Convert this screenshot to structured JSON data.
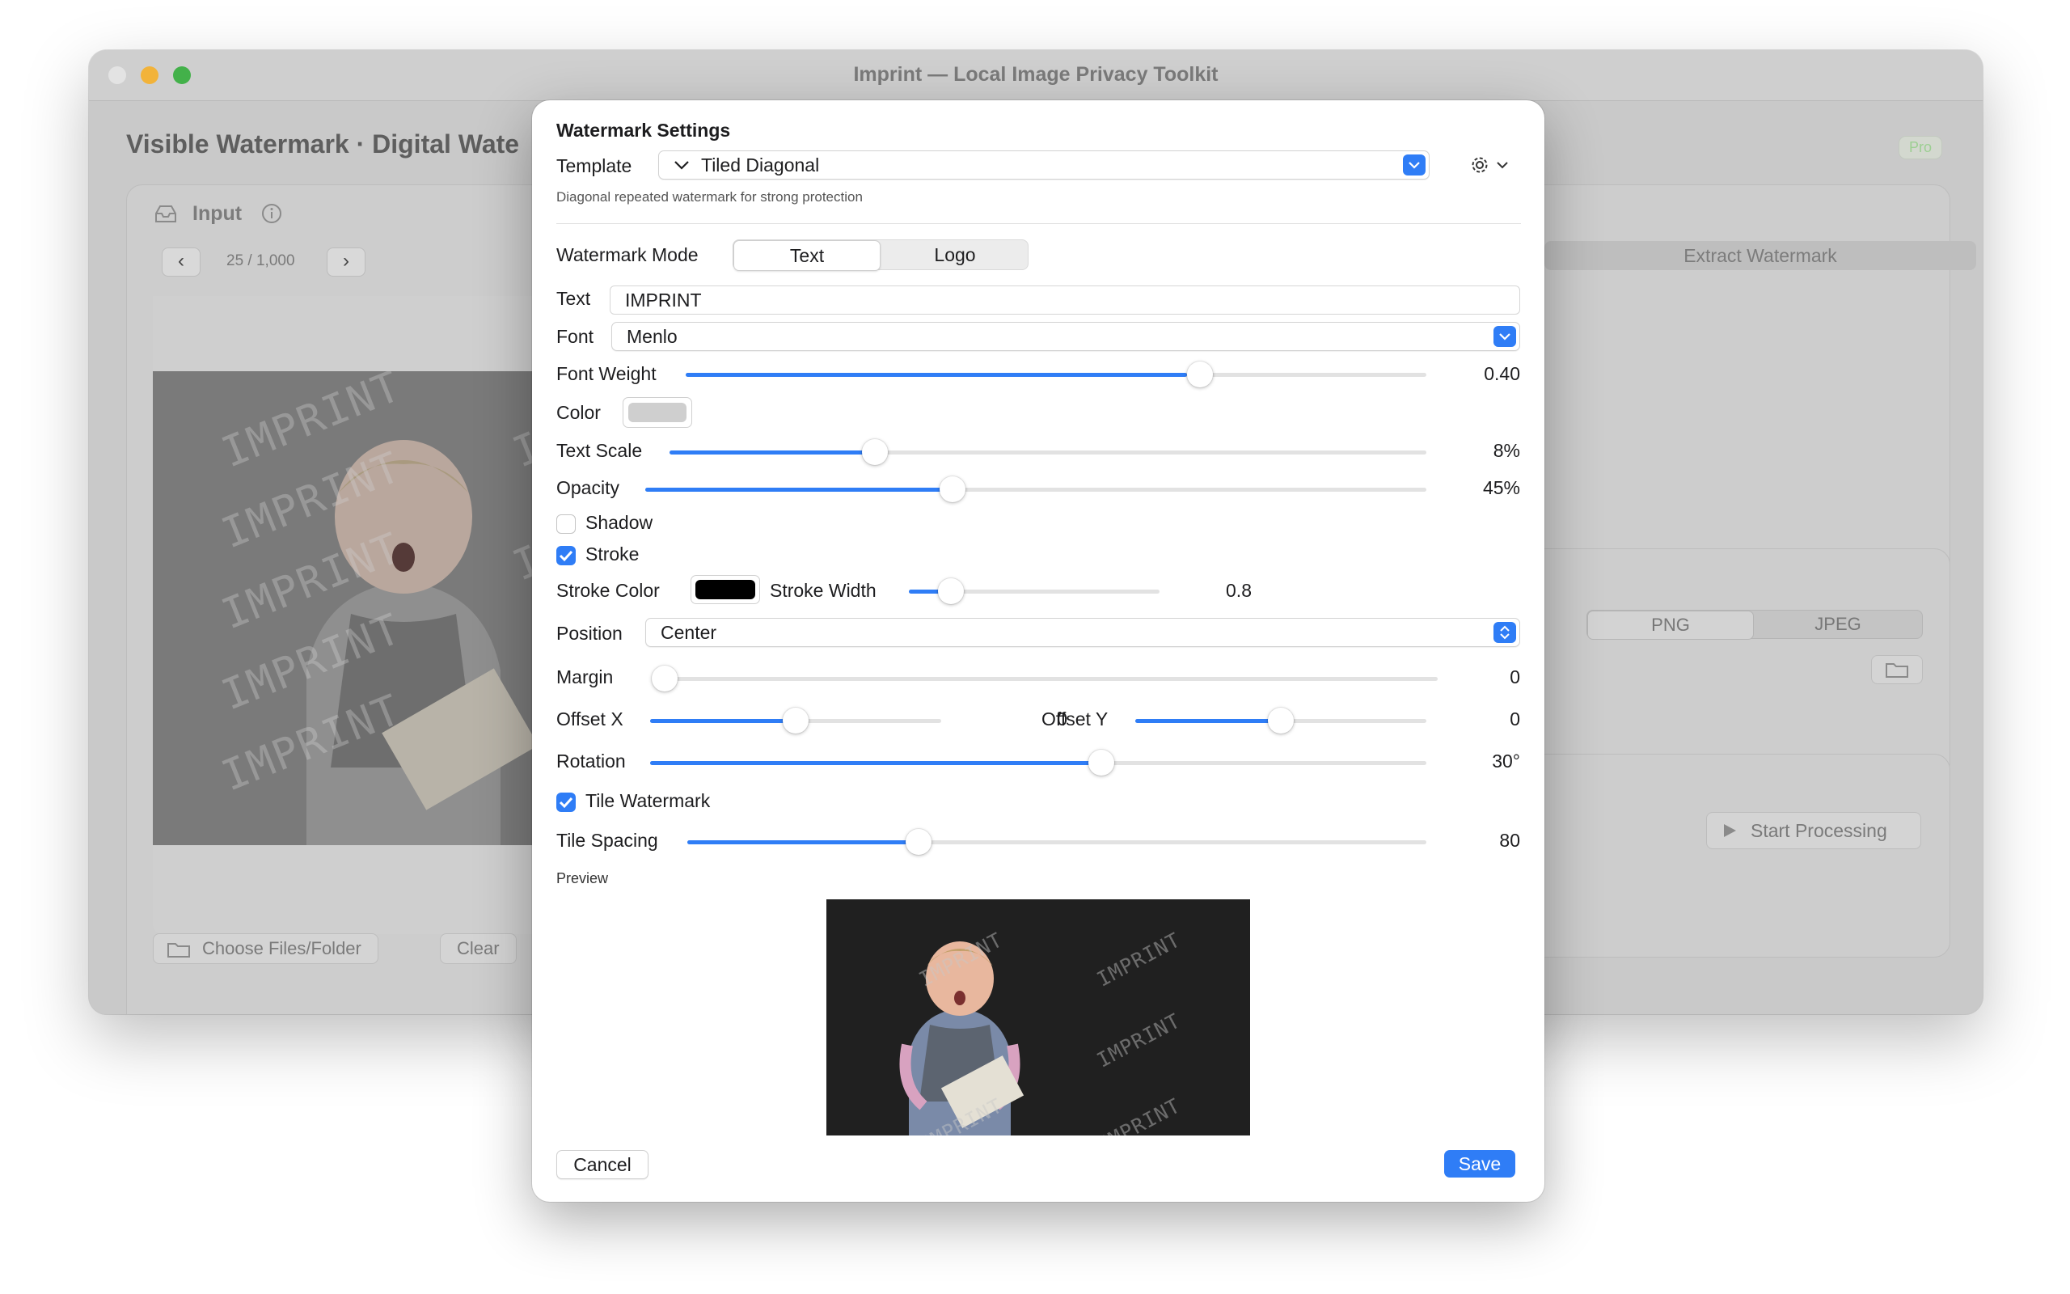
{
  "window": {
    "title": "Imprint — Local Image Privacy Toolkit",
    "page_title": "Visible Watermark · Digital Wate",
    "pro_badge": "Pro"
  },
  "input_panel": {
    "heading": "Input",
    "pager": "25 / 1,000",
    "watermark_text": "IMPRINT",
    "choose_label": "Choose Files/Folder",
    "clear_label": "Clear"
  },
  "right_panel": {
    "extract_tab": "Extract Watermark",
    "formats": [
      "PNG",
      "JPEG"
    ],
    "start_label": "Start Processing"
  },
  "sheet": {
    "title": "Watermark Settings",
    "template_label": "Template",
    "template_value": "Tiled Diagonal",
    "template_desc": "Diagonal repeated watermark for strong protection",
    "mode_label": "Watermark Mode",
    "mode_options": [
      "Text",
      "Logo"
    ],
    "mode_selected": "Text",
    "text_label": "Text",
    "text_value": "IMPRINT",
    "font_label": "Font",
    "font_value": "Menlo",
    "font_weight_label": "Font Weight",
    "font_weight_value": "0.40",
    "font_weight_fraction": 0.4,
    "color_label": "Color",
    "color_value": "#cfcfcf",
    "text_scale_label": "Text Scale",
    "text_scale_value": "8%",
    "opacity_label": "Opacity",
    "opacity_value": "45%",
    "opacity_fraction": 0.45,
    "shadow_label": "Shadow",
    "shadow_checked": false,
    "stroke_label": "Stroke",
    "stroke_checked": true,
    "stroke_color_label": "Stroke Color",
    "stroke_color_value": "#000000",
    "stroke_width_label": "Stroke Width",
    "stroke_width_value": "0.8",
    "position_label": "Position",
    "position_value": "Center",
    "margin_label": "Margin",
    "margin_value": "0",
    "offset_x_label": "Offset X",
    "offset_x_value": "0",
    "offset_y_label": "Offset Y",
    "offset_y_value": "0",
    "rotation_label": "Rotation",
    "rotation_value": "30°",
    "tile_label": "Tile Watermark",
    "tile_checked": true,
    "tile_spacing_label": "Tile Spacing",
    "tile_spacing_value": "80",
    "preview_label": "Preview",
    "preview_watermark": "IMPRINT",
    "cancel_label": "Cancel",
    "save_label": "Save"
  },
  "colors": {
    "accent": "#2f7df6",
    "watermark_color": "#cfcfcf",
    "stroke_color": "#000000"
  }
}
